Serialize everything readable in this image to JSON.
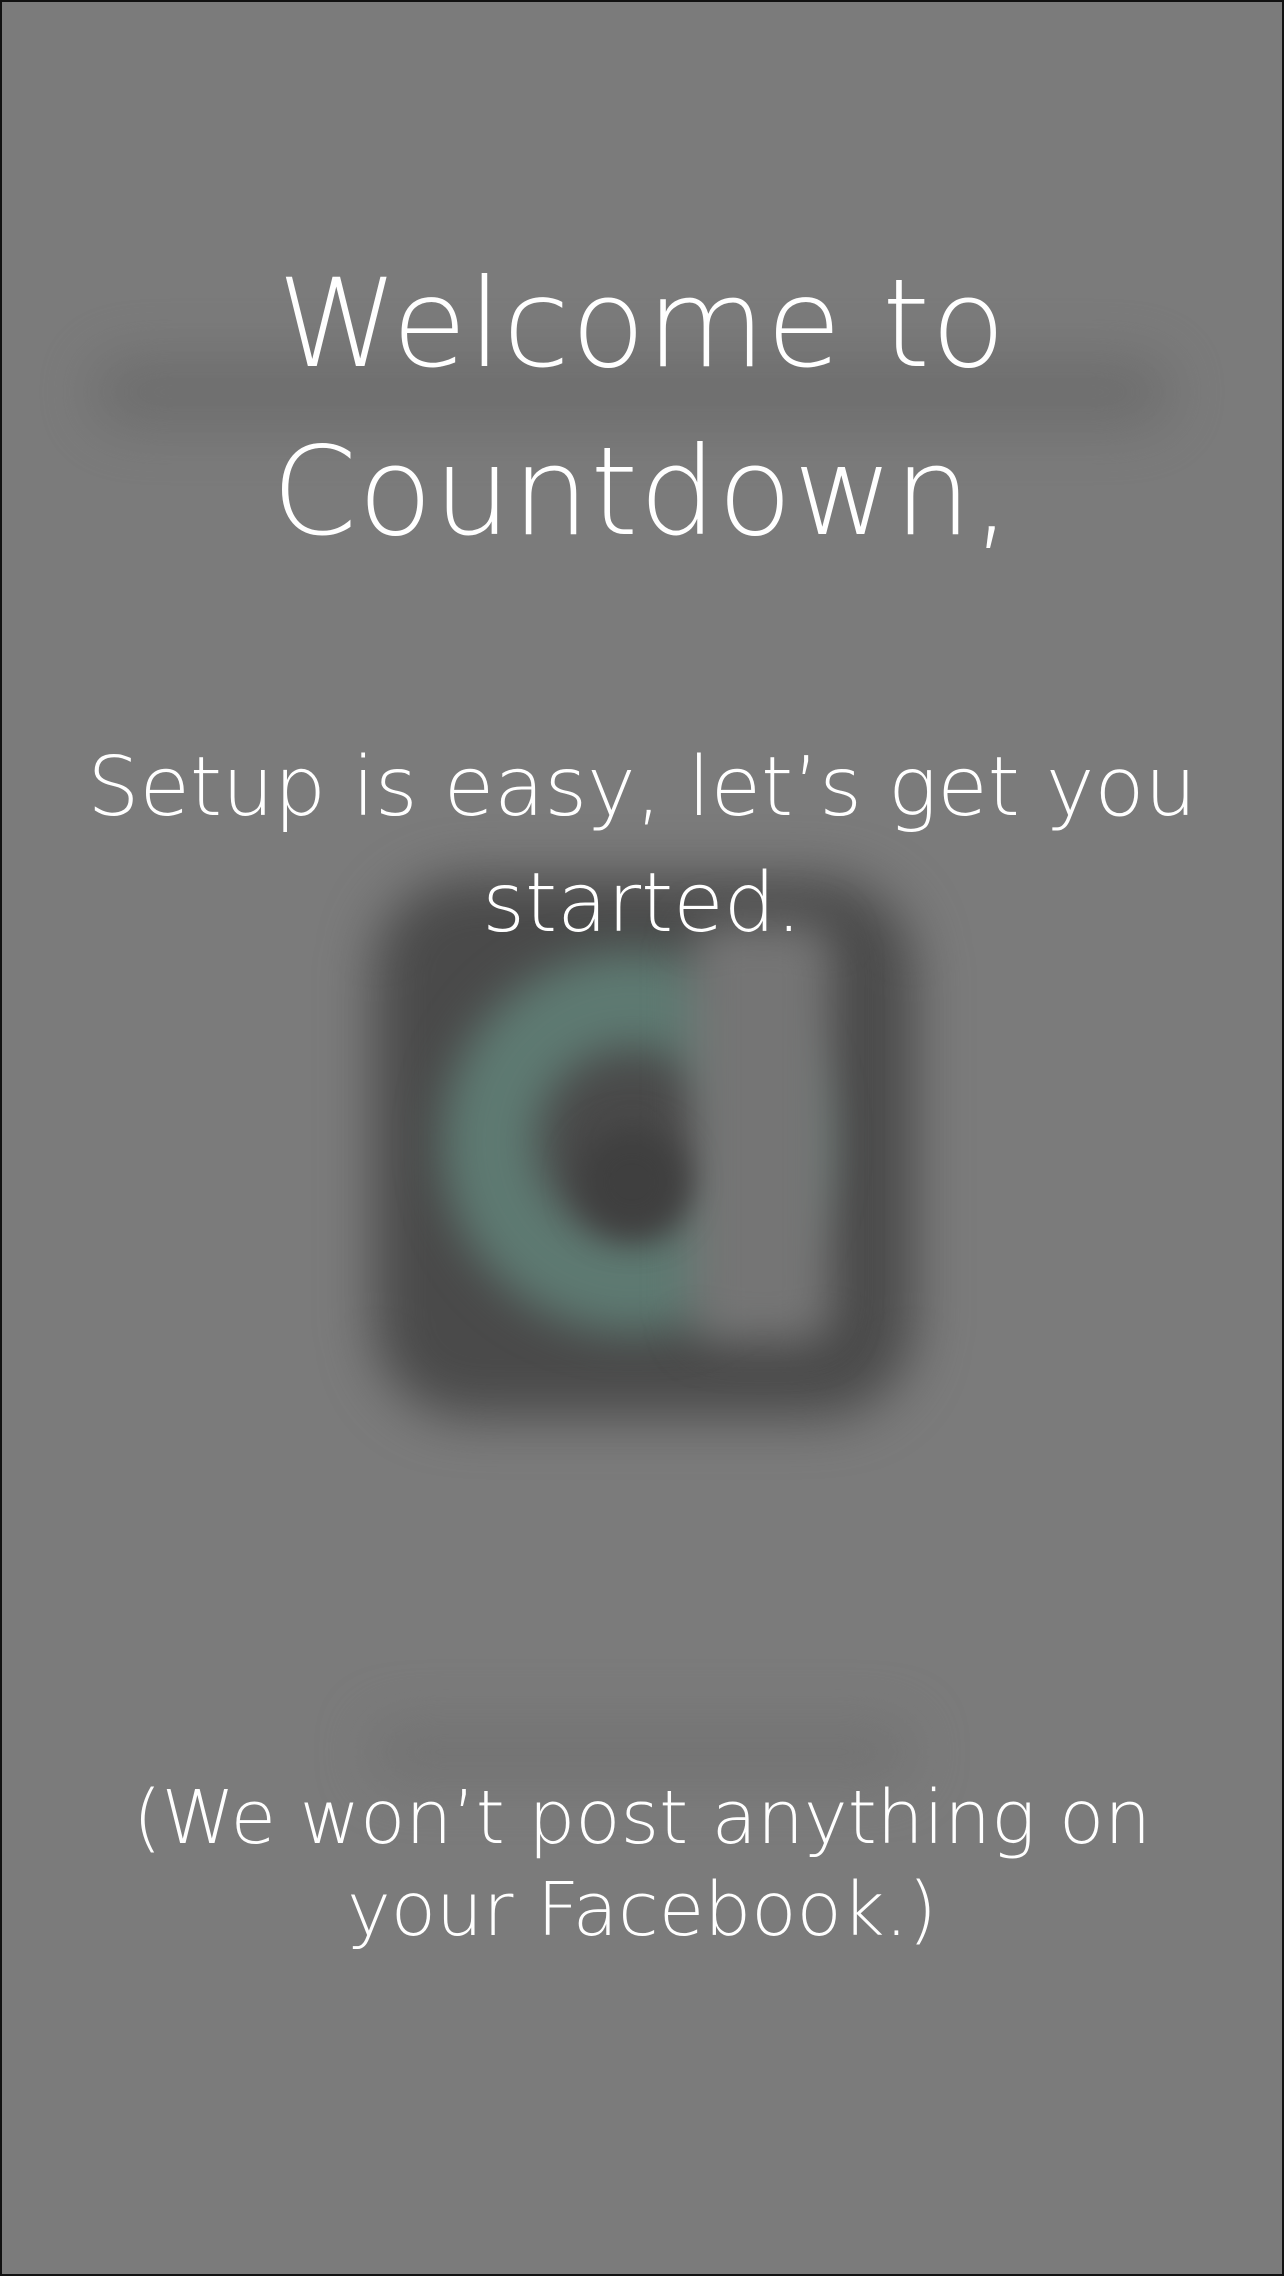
{
  "onboarding": {
    "title_line1": "Welcome to",
    "title_line2": "Countdown,",
    "subtitle_line1": "Setup is easy, let’s get you",
    "subtitle_line2": "started.",
    "note_line1": "(We won’t post anything on",
    "note_line2": "your Facebook.)"
  },
  "colors": {
    "overlay": "#7b7b7b",
    "text": "#ffffff",
    "logo_accent": "#5e7a72"
  },
  "icons": [
    "countdown-logo-icon"
  ]
}
